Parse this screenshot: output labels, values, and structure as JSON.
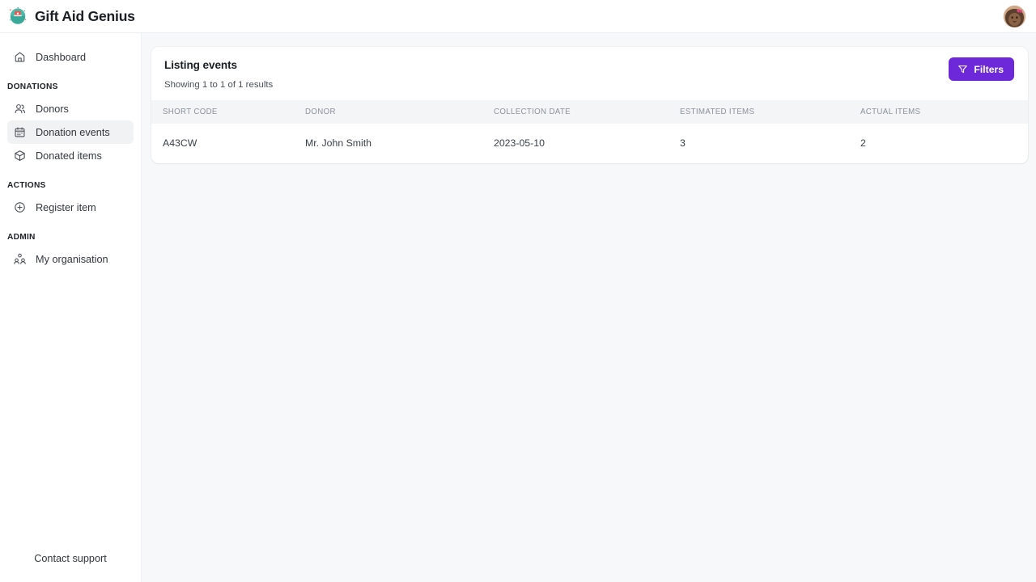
{
  "app": {
    "title": "Gift Aid Genius",
    "logo_icon": "gift-aid-genius-logo",
    "avatar_icon": "user-avatar"
  },
  "sidebar": {
    "groups": [
      {
        "label": null,
        "items": [
          {
            "label": "Dashboard",
            "icon": "home-icon",
            "active": false
          }
        ]
      },
      {
        "label": "DONATIONS",
        "items": [
          {
            "label": "Donors",
            "icon": "users-icon",
            "active": false
          },
          {
            "label": "Donation events",
            "icon": "calendar-icon",
            "active": true
          },
          {
            "label": "Donated items",
            "icon": "package-icon",
            "active": false
          }
        ]
      },
      {
        "label": "ACTIONS",
        "items": [
          {
            "label": "Register item",
            "icon": "plus-circle-icon",
            "active": false
          }
        ]
      },
      {
        "label": "ADMIN",
        "items": [
          {
            "label": "My organisation",
            "icon": "users-group-icon",
            "active": false
          }
        ]
      }
    ],
    "footer": {
      "support_label": "Contact support"
    }
  },
  "main": {
    "card": {
      "title": "Listing events",
      "subtitle": "Showing 1 to 1 of 1 results",
      "filters_button": {
        "label": "Filters",
        "icon": "funnel-icon",
        "color": "#6d28d9"
      },
      "table": {
        "columns": [
          "SHORT CODE",
          "DONOR",
          "COLLECTION DATE",
          "ESTIMATED ITEMS",
          "ACTUAL ITEMS"
        ],
        "rows": [
          {
            "short_code": "A43CW",
            "donor": "Mr. John Smith",
            "collection_date": "2023-05-10",
            "estimated_items": "3",
            "actual_items": "2"
          }
        ]
      }
    }
  }
}
